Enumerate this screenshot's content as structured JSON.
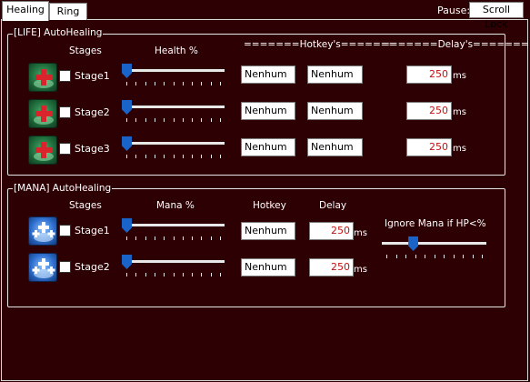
{
  "tabs": [
    {
      "label": "Healing"
    },
    {
      "label": "Ring"
    }
  ],
  "pause": {
    "label": "Pause:",
    "key": "Scroll Lock"
  },
  "life": {
    "title": "[LIFE] AutoHealing",
    "headers": {
      "stages": "Stages",
      "health": "Health %",
      "hotkeys": "=======Hotkey's=======",
      "delays": "=======Delay's======="
    },
    "rows": [
      {
        "label": "Stage1",
        "hotkey1": "Nenhum",
        "hotkey2": "Nenhum",
        "delay": "250",
        "unit": "ms",
        "slider_fraction": 0.0
      },
      {
        "label": "Stage2",
        "hotkey1": "Nenhum",
        "hotkey2": "Nenhum",
        "delay": "250",
        "unit": "ms",
        "slider_fraction": 0.0
      },
      {
        "label": "Stage3",
        "hotkey1": "Nenhum",
        "hotkey2": "Nenhum",
        "delay": "250",
        "unit": "ms",
        "slider_fraction": 0.0
      }
    ]
  },
  "mana": {
    "title": "[MANA] AutoHealing",
    "headers": {
      "stages": "Stages",
      "mana": "Mana %",
      "hotkey": "Hotkey",
      "delay": "Delay"
    },
    "rows": [
      {
        "label": "Stage1",
        "hotkey": "Nenhum",
        "delay": "250",
        "unit": "ms",
        "slider_fraction": 0.0
      },
      {
        "label": "Stage2",
        "hotkey": "Nenhum",
        "delay": "250",
        "unit": "ms",
        "slider_fraction": 0.0
      }
    ],
    "ignore_label": "Ignore Mana if HP<%",
    "ignore_slider_fraction": 0.28
  },
  "colors": {
    "background": "#2d0003",
    "accent": "#1a63c9",
    "delay_text": "#c51010"
  },
  "icons": {
    "life": "health-potion-icon",
    "mana": "mana-potion-icon"
  }
}
